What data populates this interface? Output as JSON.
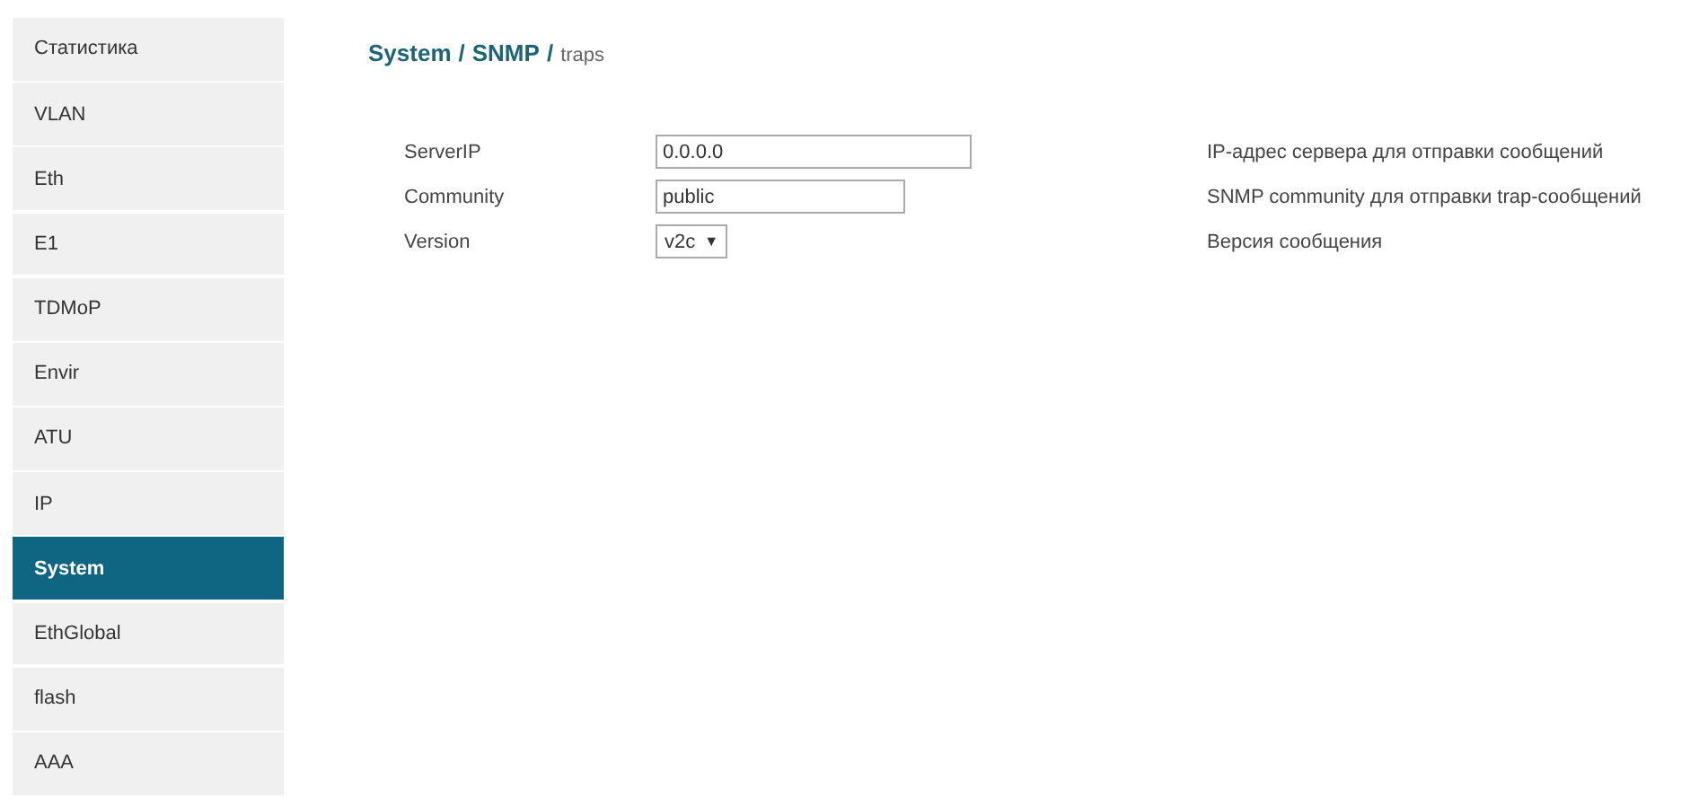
{
  "sidebar": {
    "items": [
      {
        "label": "Статистика",
        "selected": false
      },
      {
        "label": "VLAN",
        "selected": false
      },
      {
        "label": "Eth",
        "selected": false
      },
      {
        "label": "E1",
        "selected": false
      },
      {
        "label": "TDMoP",
        "selected": false
      },
      {
        "label": "Envir",
        "selected": false
      },
      {
        "label": "ATU",
        "selected": false
      },
      {
        "label": "IP",
        "selected": false
      },
      {
        "label": "System",
        "selected": true
      },
      {
        "label": "EthGlobal",
        "selected": false
      },
      {
        "label": "flash",
        "selected": false
      },
      {
        "label": "AAA",
        "selected": false
      }
    ]
  },
  "breadcrumb": [
    {
      "kind": "link",
      "text": "System"
    },
    {
      "kind": "separator",
      "text": "/"
    },
    {
      "kind": "link",
      "text": "SNMP"
    },
    {
      "kind": "separator",
      "text": "/"
    },
    {
      "kind": "current",
      "text": "traps"
    }
  ],
  "form": {
    "rows": [
      {
        "kind": "text",
        "label": "ServerIP",
        "value": "0.0.0.0",
        "description": "IP-адрес сервера для отправки сообщений"
      },
      {
        "kind": "text",
        "label": "Community",
        "value": "public",
        "description": "SNMP community для отправки trap-сообщений"
      },
      {
        "kind": "select",
        "label": "Version",
        "value": "v2c",
        "arrow": "▼",
        "description": "Версия сообщения"
      }
    ]
  }
}
